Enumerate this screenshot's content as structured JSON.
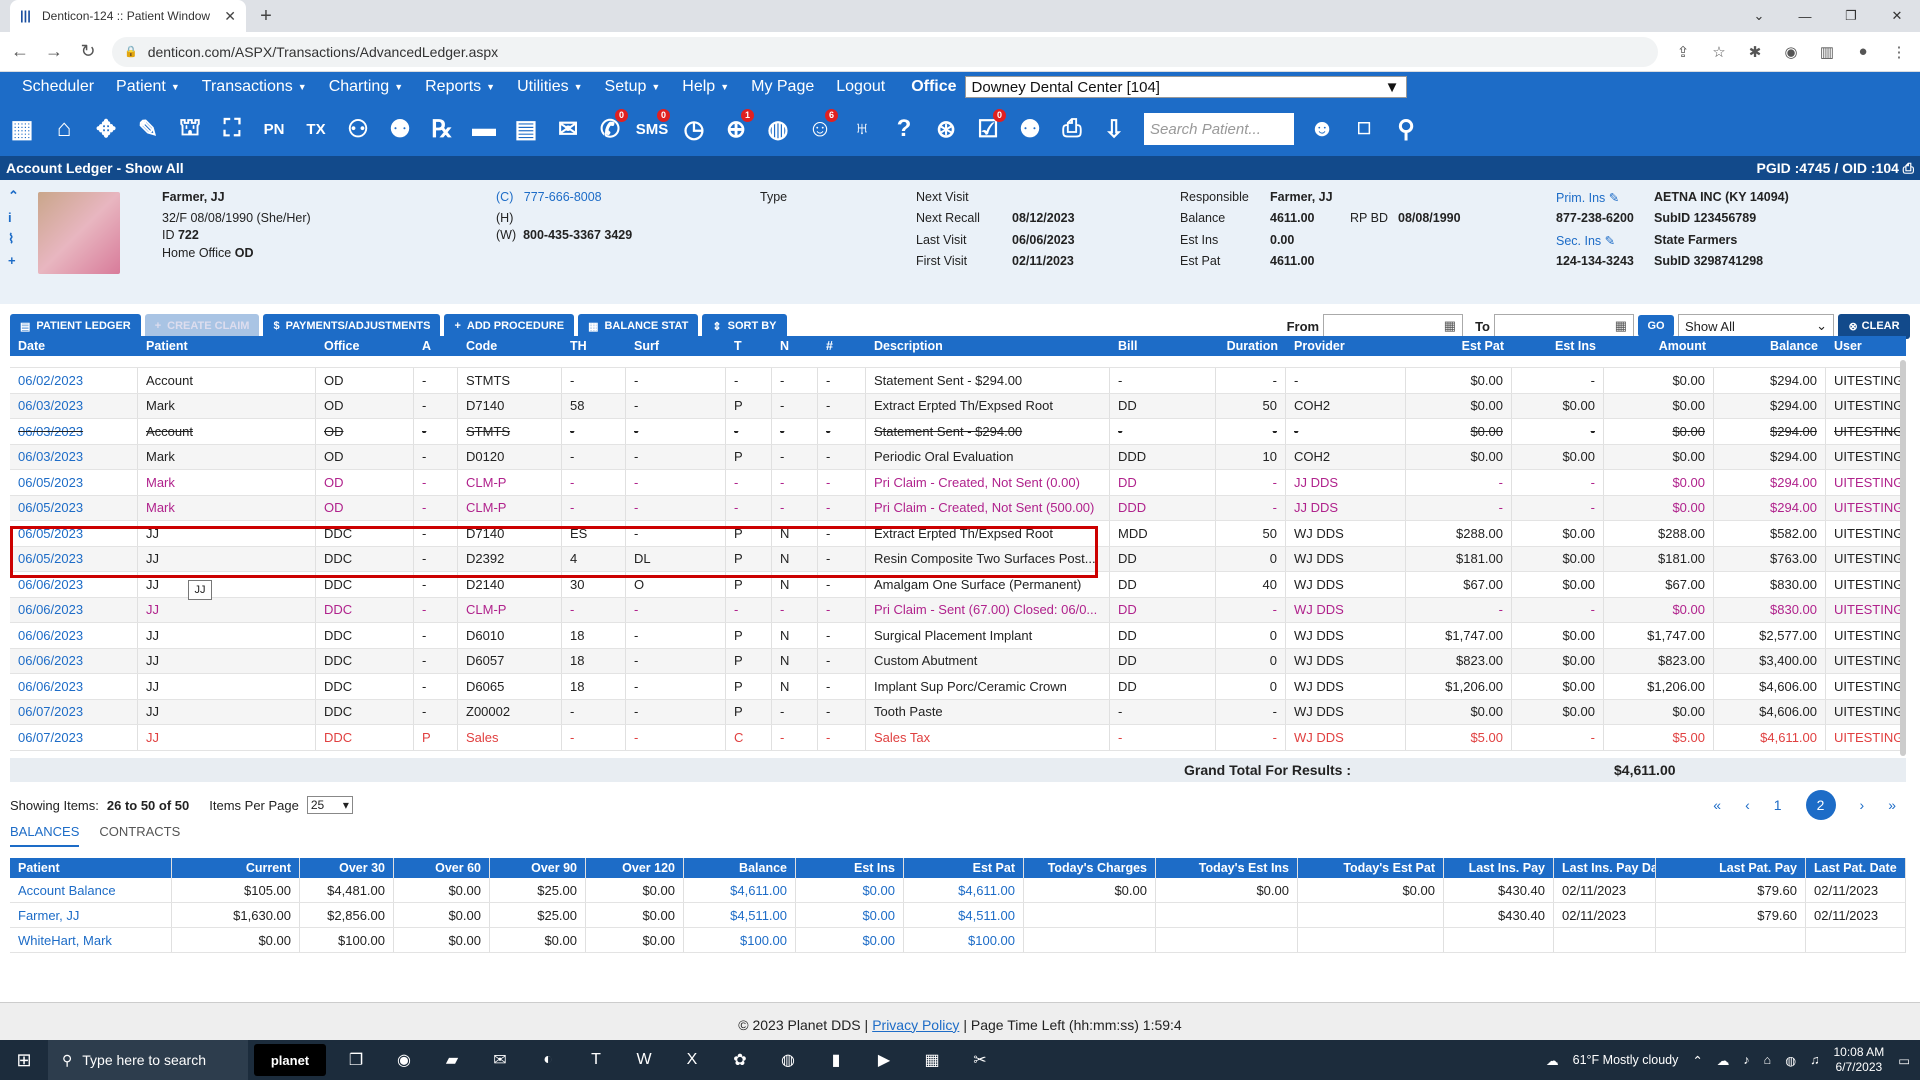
{
  "browser": {
    "tab_title": "Denticon-124 :: Patient Window",
    "url": "denticon.com/ASPX/Transactions/AdvancedLedger.aspx"
  },
  "menu": {
    "items": [
      "Scheduler",
      "Patient",
      "Transactions",
      "Charting",
      "Reports",
      "Utilities",
      "Setup",
      "Help",
      "My Page",
      "Logout"
    ],
    "has_caret": [
      false,
      true,
      true,
      true,
      true,
      true,
      true,
      true,
      false,
      false
    ],
    "office_label": "Office",
    "office_value": "Downey Dental Center [104]"
  },
  "toolbar": {
    "search_placeholder": "Search Patient...",
    "icons": [
      {
        "name": "calendar-icon",
        "glyph": "▦",
        "badge": ""
      },
      {
        "name": "home-icon",
        "glyph": "⌂",
        "badge": ""
      },
      {
        "name": "transfer-icon",
        "glyph": "✥",
        "badge": ""
      },
      {
        "name": "notes-icon",
        "glyph": "✎",
        "badge": ""
      },
      {
        "name": "tooth-icon",
        "glyph": "⛫",
        "badge": ""
      },
      {
        "name": "tooth-chart-icon",
        "glyph": "⛶",
        "badge": ""
      },
      {
        "name": "pn-icon",
        "glyph": "PN",
        "badge": ""
      },
      {
        "name": "tx-icon",
        "glyph": "TX",
        "badge": ""
      },
      {
        "name": "add-person-icon",
        "glyph": "⚇",
        "badge": ""
      },
      {
        "name": "add-group-icon",
        "glyph": "⚉",
        "badge": ""
      },
      {
        "name": "rx-icon",
        "glyph": "℞",
        "badge": ""
      },
      {
        "name": "card-icon",
        "glyph": "▬",
        "badge": ""
      },
      {
        "name": "printer-doc-icon",
        "glyph": "▤",
        "badge": ""
      },
      {
        "name": "mail-icon",
        "glyph": "✉",
        "badge": ""
      },
      {
        "name": "message-icon",
        "glyph": "✆",
        "badge": "0"
      },
      {
        "name": "sms-icon",
        "glyph": "SMS",
        "badge": "0"
      },
      {
        "name": "clock-icon",
        "glyph": "◷",
        "badge": ""
      },
      {
        "name": "globe-users-icon",
        "glyph": "⊕",
        "badge": "1"
      },
      {
        "name": "world-icon",
        "glyph": "◍",
        "badge": ""
      },
      {
        "name": "smile-icon",
        "glyph": "☺",
        "badge": "6"
      },
      {
        "name": "tooth-outline-icon",
        "glyph": "♅",
        "badge": ""
      },
      {
        "name": "help-tooth-icon",
        "glyph": "?",
        "badge": ""
      },
      {
        "name": "network-icon",
        "glyph": "⊛",
        "badge": ""
      },
      {
        "name": "checklist-icon",
        "glyph": "☑",
        "badge": "0"
      },
      {
        "name": "family-icon",
        "glyph": "⚉",
        "badge": ""
      },
      {
        "name": "print-icon",
        "glyph": "⎙",
        "badge": ""
      },
      {
        "name": "download-icon",
        "glyph": "⇩",
        "badge": ""
      }
    ]
  },
  "page_bar": {
    "title": "Account Ledger - Show All",
    "ids": "PGID :4745 / OID :104"
  },
  "patient": {
    "name": "Farmer, JJ",
    "demo": "32/F  08/08/1990  (She/Her)",
    "id_label": "ID",
    "id": "722",
    "home_office_label": "Home Office",
    "home_office": "OD",
    "phone_c_label": "(C)",
    "phone_c": "777-666-8008",
    "phone_h_label": "(H)",
    "phone_w_label": "(W)",
    "phone_w": "800-435-3367 3429",
    "type_label": "Type",
    "next_visit_label": "Next Visit",
    "next_recall_label": "Next Recall",
    "next_recall": "08/12/2023",
    "last_visit_label": "Last Visit",
    "last_visit": "06/06/2023",
    "first_visit_label": "First Visit",
    "first_visit": "02/11/2023",
    "responsible_label": "Responsible",
    "responsible": "Farmer, JJ",
    "balance_label": "Balance",
    "balance": "4611.00",
    "rpbd_label": "RP BD",
    "rpbd": "08/08/1990",
    "est_ins_label": "Est Ins",
    "est_ins": "0.00",
    "est_pat_label": "Est Pat",
    "est_pat": "4611.00",
    "prim_ins_label": "Prim. Ins",
    "prim_ins": "AETNA INC (KY 14094)",
    "prim_phone": "877-238-6200",
    "prim_subid": "SubID 123456789",
    "sec_ins_label": "Sec. Ins",
    "sec_ins": "State Farmers",
    "sec_phone": "124-134-3243",
    "sec_subid": "SubID 3298741298"
  },
  "actions": {
    "patient_ledger": "PATIENT LEDGER",
    "create_claim": "CREATE CLAIM",
    "payments": "PAYMENTS/ADJUSTMENTS",
    "add_procedure": "ADD PROCEDURE",
    "balance_stat": "BALANCE STAT",
    "sort_by": "SORT BY",
    "from_label": "From",
    "to_label": "To",
    "go": "GO",
    "filter_value": "Show All",
    "clear": "CLEAR"
  },
  "ledger": {
    "columns": [
      "Date",
      "Patient",
      "Office",
      "A",
      "Code",
      "TH",
      "Surf",
      "T",
      "N",
      "#",
      "Description",
      "Bill",
      "Duration",
      "Provider",
      "Est Pat",
      "Est Ins",
      "Amount",
      "Balance",
      "User"
    ],
    "rows": [
      {
        "style": "",
        "cells": [
          "06/02/2023",
          "Account",
          "OD",
          "-",
          "STMTS",
          "-",
          "-",
          "-",
          "-",
          "-",
          "Statement Sent - $294.00",
          "-",
          "-",
          "-",
          "$0.00",
          "-",
          "$0.00",
          "$294.00",
          "UITESTING"
        ]
      },
      {
        "style": "",
        "cells": [
          "06/03/2023",
          "Mark",
          "OD",
          "-",
          "D7140",
          "58",
          "-",
          "P",
          "-",
          "-",
          "Extract Erpted Th/Expsed Root",
          "DD",
          "50",
          "COH2",
          "$0.00",
          "$0.00",
          "$0.00",
          "$294.00",
          "UITESTING"
        ]
      },
      {
        "style": "row-strike",
        "cells": [
          "06/03/2023",
          "Account",
          "OD",
          "-",
          "STMTS",
          "-",
          "-",
          "-",
          "-",
          "-",
          "Statement Sent - $294.00",
          "-",
          "-",
          "-",
          "$0.00",
          "-",
          "$0.00",
          "$294.00",
          "UITESTING"
        ]
      },
      {
        "style": "",
        "cells": [
          "06/03/2023",
          "Mark",
          "OD",
          "-",
          "D0120",
          "-",
          "-",
          "P",
          "-",
          "-",
          "Periodic Oral Evaluation",
          "DDD",
          "10",
          "COH2",
          "$0.00",
          "$0.00",
          "$0.00",
          "$294.00",
          "UITESTING"
        ]
      },
      {
        "style": "row-purple",
        "cells": [
          "06/05/2023",
          "Mark",
          "OD",
          "-",
          "CLM-P",
          "-",
          "-",
          "-",
          "-",
          "-",
          "Pri Claim - Created, Not Sent (0.00)",
          "DD",
          "-",
          "JJ DDS",
          "-",
          "-",
          "$0.00",
          "$294.00",
          "UITESTING"
        ]
      },
      {
        "style": "row-purple",
        "cells": [
          "06/05/2023",
          "Mark",
          "OD",
          "-",
          "CLM-P",
          "-",
          "-",
          "-",
          "-",
          "-",
          "Pri Claim - Created, Not Sent (500.00)",
          "DDD",
          "-",
          "JJ DDS",
          "-",
          "-",
          "$0.00",
          "$294.00",
          "UITESTING"
        ]
      },
      {
        "style": "",
        "cells": [
          "06/05/2023",
          "JJ",
          "DDC",
          "-",
          "D7140",
          "ES",
          "-",
          "P",
          "N",
          "-",
          "Extract Erpted Th/Expsed Root",
          "MDD",
          "50",
          "WJ DDS",
          "$288.00",
          "$0.00",
          "$288.00",
          "$582.00",
          "UITESTING"
        ]
      },
      {
        "style": "",
        "cells": [
          "06/05/2023",
          "JJ",
          "DDC",
          "-",
          "D2392",
          "4",
          "DL",
          "P",
          "N",
          "-",
          "Resin Composite Two Surfaces Post...",
          "DD",
          "0",
          "WJ DDS",
          "$181.00",
          "$0.00",
          "$181.00",
          "$763.00",
          "UITESTING"
        ]
      },
      {
        "style": "",
        "cells": [
          "06/06/2023",
          "JJ",
          "DDC",
          "-",
          "D2140",
          "30",
          "O",
          "P",
          "N",
          "-",
          "Amalgam One Surface (Permanent)",
          "DD",
          "40",
          "WJ DDS",
          "$67.00",
          "$0.00",
          "$67.00",
          "$830.00",
          "UITESTING"
        ]
      },
      {
        "style": "row-purple",
        "cells": [
          "06/06/2023",
          "JJ",
          "DDC",
          "-",
          "CLM-P",
          "-",
          "-",
          "-",
          "-",
          "-",
          "Pri Claim - Sent (67.00) Closed: 06/0...",
          "DD",
          "-",
          "WJ DDS",
          "-",
          "-",
          "$0.00",
          "$830.00",
          "UITESTING"
        ]
      },
      {
        "style": "",
        "cells": [
          "06/06/2023",
          "JJ",
          "DDC",
          "-",
          "D6010",
          "18",
          "-",
          "P",
          "N",
          "-",
          "Surgical Placement Implant",
          "DD",
          "0",
          "WJ DDS",
          "$1,747.00",
          "$0.00",
          "$1,747.00",
          "$2,577.00",
          "UITESTING"
        ]
      },
      {
        "style": "",
        "cells": [
          "06/06/2023",
          "JJ",
          "DDC",
          "-",
          "D6057",
          "18",
          "-",
          "P",
          "N",
          "-",
          "Custom Abutment",
          "DD",
          "0",
          "WJ DDS",
          "$823.00",
          "$0.00",
          "$823.00",
          "$3,400.00",
          "UITESTING"
        ]
      },
      {
        "style": "",
        "cells": [
          "06/06/2023",
          "JJ",
          "DDC",
          "-",
          "D6065",
          "18",
          "-",
          "P",
          "N",
          "-",
          "Implant Sup Porc/Ceramic Crown",
          "DD",
          "0",
          "WJ DDS",
          "$1,206.00",
          "$0.00",
          "$1,206.00",
          "$4,606.00",
          "UITESTING"
        ]
      },
      {
        "style": "",
        "cells": [
          "06/07/2023",
          "JJ",
          "DDC",
          "-",
          "Z00002",
          "-",
          "-",
          "P",
          "-",
          "-",
          "Tooth Paste",
          "-",
          "-",
          "WJ DDS",
          "$0.00",
          "$0.00",
          "$0.00",
          "$4,606.00",
          "UITESTING"
        ]
      },
      {
        "style": "row-red",
        "cells": [
          "06/07/2023",
          "JJ",
          "DDC",
          "P",
          "Sales",
          "-",
          "-",
          "C",
          "-",
          "-",
          "Sales Tax",
          "-",
          "-",
          "WJ DDS",
          "$5.00",
          "-",
          "$5.00",
          "$4,611.00",
          "UITESTING"
        ]
      }
    ],
    "grand_total_label": "Grand Total For Results :",
    "grand_total": "$4,611.00"
  },
  "paging": {
    "showing_label": "Showing Items:",
    "showing_value": "26 to 50 of 50",
    "ipp_label": "Items Per Page",
    "ipp_value": "25",
    "first": "«",
    "prev": "‹",
    "page1": "1",
    "page2": "2",
    "next": "›",
    "last": "»"
  },
  "subtabs": {
    "balances": "BALANCES",
    "contracts": "CONTRACTS"
  },
  "balances": {
    "columns": [
      "Patient",
      "Current",
      "Over 30",
      "Over 60",
      "Over 90",
      "Over 120",
      "Balance",
      "Est Ins",
      "Est Pat",
      "Today's Charges",
      "Today's Est Ins",
      "Today's Est Pat",
      "Last Ins. Pay",
      "Last Ins. Pay Date",
      "Last Pat. Pay",
      "Last Pat. Date"
    ],
    "rows": [
      [
        "Account Balance",
        "$105.00",
        "$4,481.00",
        "$0.00",
        "$25.00",
        "$0.00",
        "$4,611.00",
        "$0.00",
        "$4,611.00",
        "$0.00",
        "$0.00",
        "$0.00",
        "$430.40",
        "02/11/2023",
        "$79.60",
        "02/11/2023"
      ],
      [
        "Farmer, JJ",
        "$1,630.00",
        "$2,856.00",
        "$0.00",
        "$25.00",
        "$0.00",
        "$4,511.00",
        "$0.00",
        "$4,511.00",
        "",
        "",
        "",
        "$430.40",
        "02/11/2023",
        "$79.60",
        "02/11/2023"
      ],
      [
        "WhiteHart, Mark",
        "$0.00",
        "$100.00",
        "$0.00",
        "$0.00",
        "$0.00",
        "$100.00",
        "$0.00",
        "$100.00",
        "",
        "",
        "",
        "",
        "",
        "",
        ""
      ]
    ]
  },
  "footer": {
    "copyright": "© 2023 Planet DDS |",
    "privacy": "Privacy Policy",
    "time_left": "| Page Time Left (hh:mm:ss) 1:59:4"
  },
  "taskbar": {
    "search_placeholder": "Type here to search",
    "planet": "planet",
    "weather": "61°F  Mostly cloudy",
    "time": "10:08 AM",
    "date": "6/7/2023"
  },
  "colors": {
    "brand_blue": "#1d6cc7",
    "dark_blue": "#124a8b",
    "highlight_red": "#cc0000"
  }
}
